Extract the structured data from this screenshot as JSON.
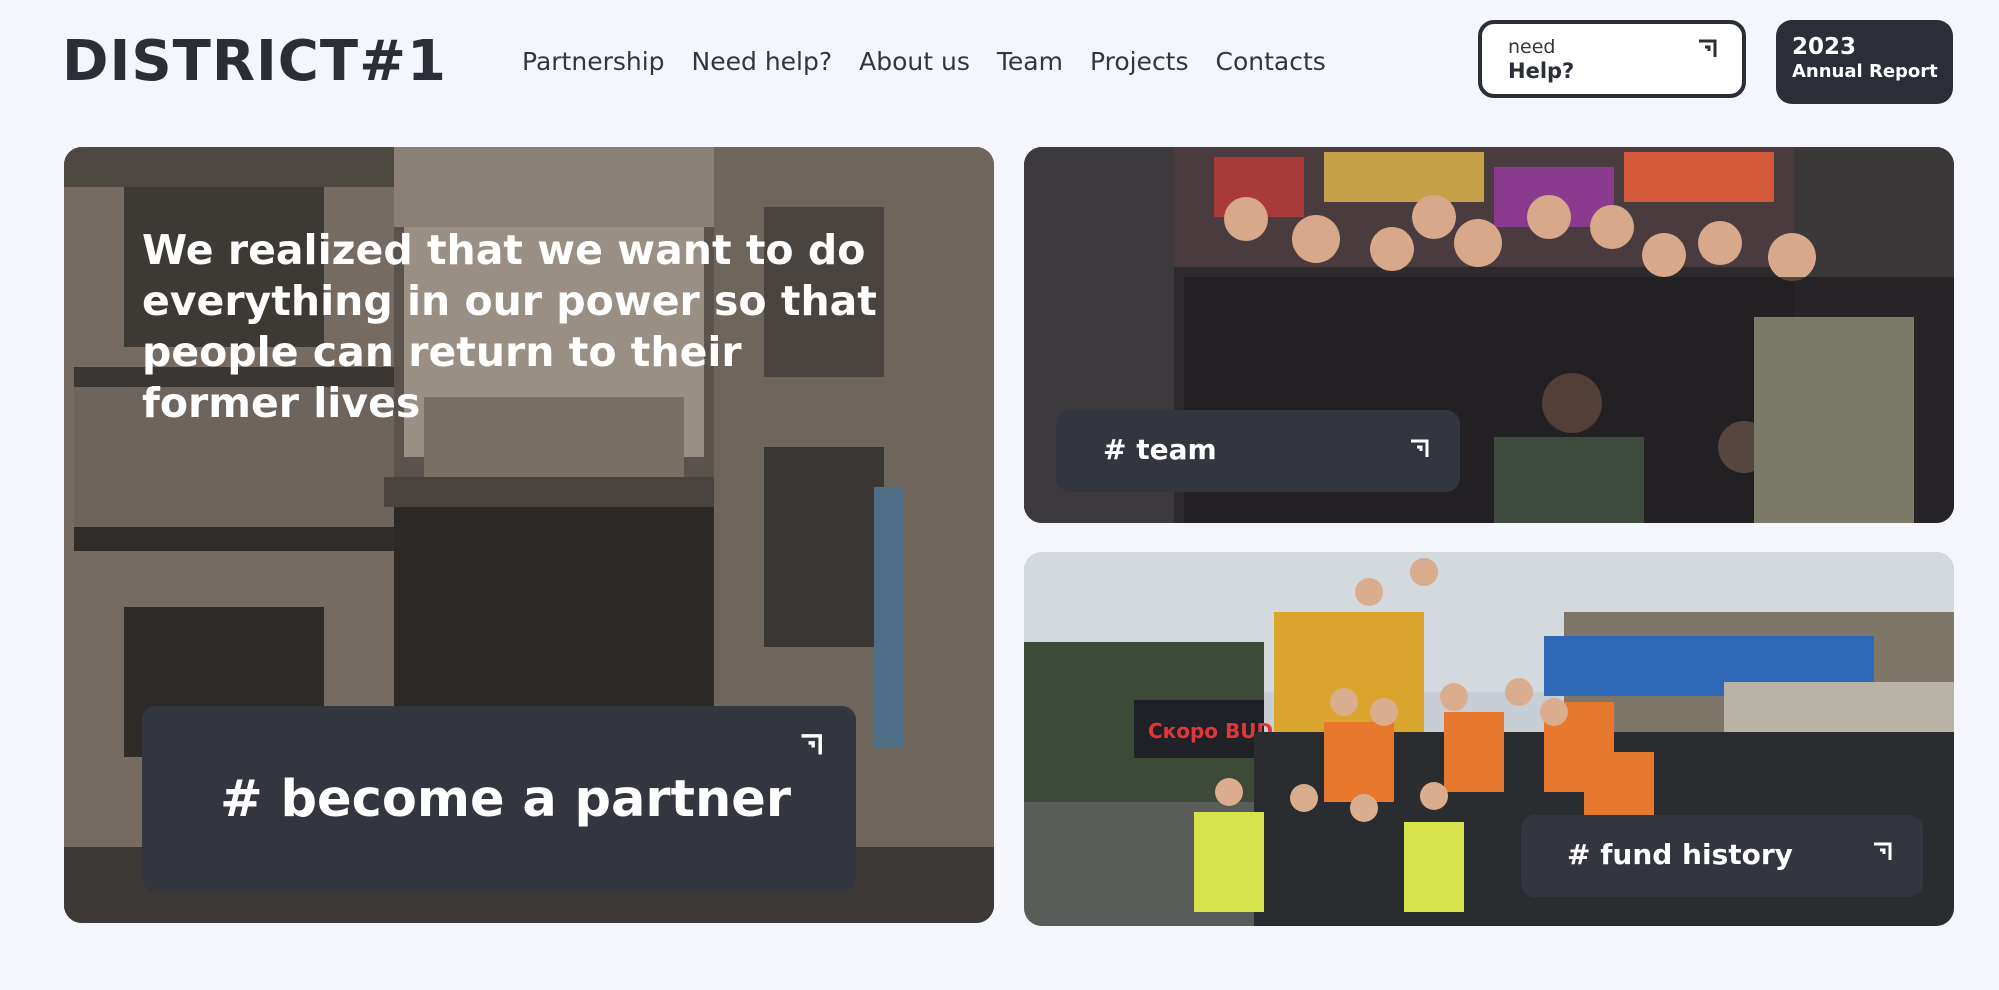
{
  "brand": {
    "logo": "DISTRICT#1"
  },
  "nav": {
    "items": [
      {
        "label": "Partnership"
      },
      {
        "label": "Need help?"
      },
      {
        "label": "About us"
      },
      {
        "label": "Team"
      },
      {
        "label": "Projects"
      },
      {
        "label": "Contacts"
      }
    ]
  },
  "help_button": {
    "small": "need",
    "big": "Help?",
    "icon": "arrow-corner-icon"
  },
  "report_button": {
    "year": "2023",
    "label": "Annual Report"
  },
  "hero": {
    "quote": "We realized that we want to do everything in our power so that people can return to their former lives",
    "cta": "# become a partner"
  },
  "team_card": {
    "cta": "# team"
  },
  "fund_card": {
    "cta": "# fund history",
    "sign_text": "Скоро BUD"
  },
  "colors": {
    "background": "#f4f6fb",
    "dark": "#2b2e36",
    "cta_bg": "#34363f",
    "white": "#ffffff"
  }
}
